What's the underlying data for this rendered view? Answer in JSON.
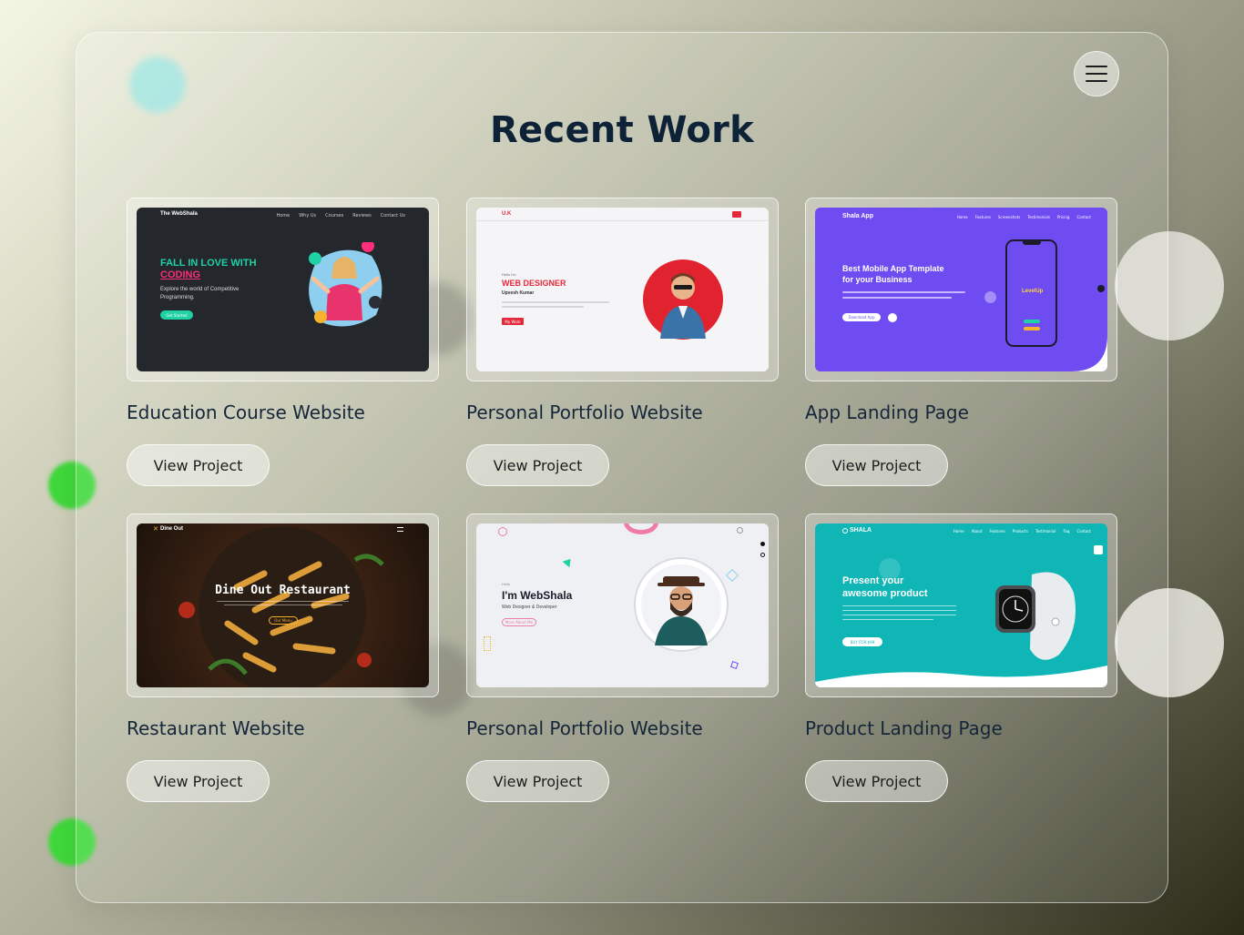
{
  "page": {
    "title": "Recent Work"
  },
  "menu": {
    "icon": "hamburger-menu-icon"
  },
  "projects": [
    {
      "title": "Education Course Website",
      "button": "View Project",
      "preview": {
        "brand": "The WebShala",
        "nav": [
          "Home",
          "Why Us",
          "Courses",
          "Reviews",
          "Contact Us"
        ],
        "headline_1": "FALL IN LOVE WITH",
        "headline_2": "CODING",
        "text": "Explore the world of Competitive Programming.",
        "cta": "Get Started"
      }
    },
    {
      "title": "Personal Portfolio Website",
      "button": "View Project",
      "preview": {
        "brand": "U.K",
        "greeting": "Hello I'm",
        "role": "WEB DESIGNER",
        "name": "Upvesh Kumar",
        "cta": "My Work"
      }
    },
    {
      "title": "App Landing Page",
      "button": "View Project",
      "preview": {
        "brand": "Shala App",
        "nav": [
          "Home",
          "Features",
          "Screenshots",
          "Testimonials",
          "Pricing",
          "Contact"
        ],
        "headline_1": "Best Mobile App Template",
        "headline_2": "for your Business",
        "cta": "Download App",
        "phone_text": "LevelUp"
      }
    },
    {
      "title": "Restaurant Website",
      "button": "View Project",
      "preview": {
        "brand": "Dine Out",
        "headline": "Dine Out Restaurant",
        "cta": "Our Menu"
      }
    },
    {
      "title": "Personal Portfolio Website",
      "button": "View Project",
      "preview": {
        "greeting": "Hello",
        "headline": "I'm WebShala",
        "subtitle": "Web Designer & Developer",
        "cta": "More About Me"
      }
    },
    {
      "title": "Product Landing Page",
      "button": "View Project",
      "preview": {
        "brand": "SHALA",
        "nav": [
          "Home",
          "About",
          "Features",
          "Products",
          "Testimonial",
          "Faq",
          "Contact"
        ],
        "headline_1": "Present your",
        "headline_2": "awesome product",
        "cta": "BUY FOR $99"
      }
    }
  ],
  "colors": {
    "title": "#0d2137",
    "edu_accent": "#1fd1a5",
    "edu_pink": "#ff2d7a",
    "portfolio_red": "#e5283a",
    "app_purple": "#6f4bf2",
    "product_teal": "#10b6b6"
  }
}
